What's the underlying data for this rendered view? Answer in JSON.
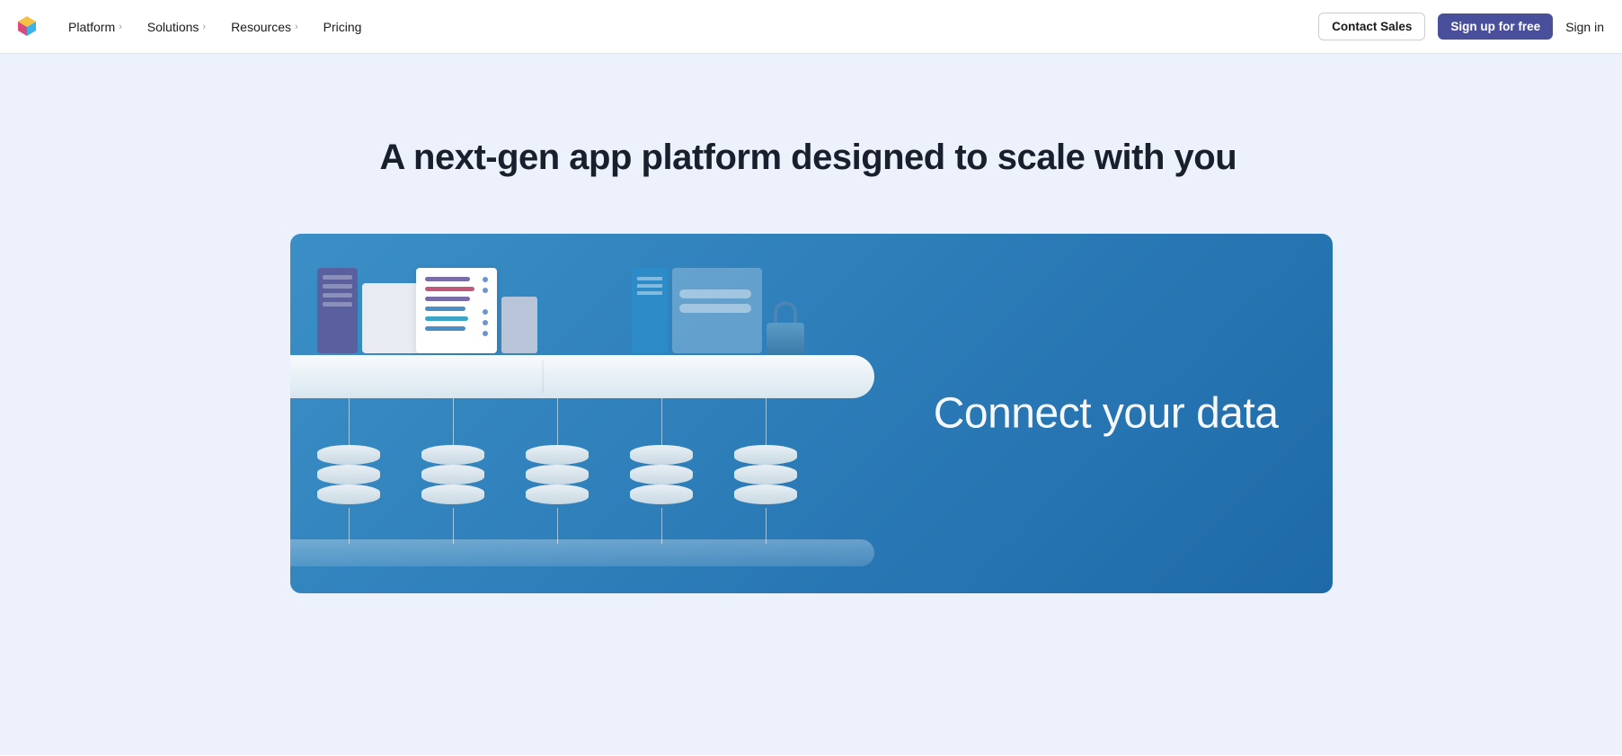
{
  "nav": {
    "items": [
      {
        "label": "Platform",
        "hasDropdown": true
      },
      {
        "label": "Solutions",
        "hasDropdown": true
      },
      {
        "label": "Resources",
        "hasDropdown": true
      },
      {
        "label": "Pricing",
        "hasDropdown": false
      }
    ],
    "contactSales": "Contact Sales",
    "signUp": "Sign up for free",
    "signIn": "Sign in"
  },
  "hero": {
    "title": "A next-gen app platform designed to scale with you",
    "featureTagline": "Connect your data"
  }
}
